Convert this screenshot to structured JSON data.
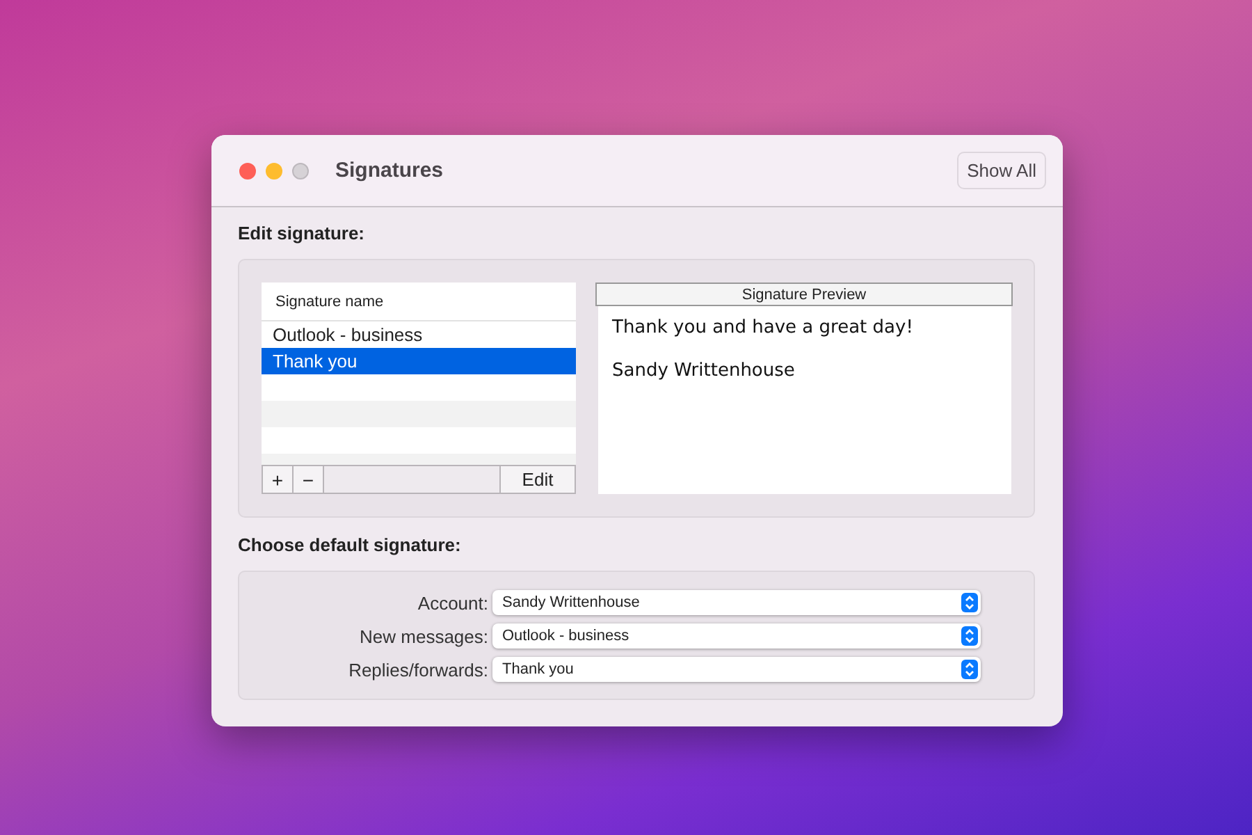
{
  "window": {
    "title": "Signatures",
    "controls": [
      {
        "kind": "close"
      },
      {
        "kind": "minimize"
      },
      {
        "kind": "zoom"
      }
    ],
    "toolbar_button": "Show All"
  },
  "edit_section": {
    "heading": "Edit signature:",
    "list": {
      "column": "Signature name",
      "rows": [
        {
          "label": "Outlook - business",
          "selected": false
        },
        {
          "label": "Thank you",
          "selected": true
        }
      ],
      "buttons": [
        {
          "kind": "add",
          "label": "+"
        },
        {
          "kind": "remove",
          "label": "−"
        },
        {
          "kind": "edit",
          "label": "Edit"
        }
      ]
    },
    "preview": {
      "header": "Signature Preview",
      "lines": [
        "Thank you and have a great day!",
        "Sandy Writtenhouse"
      ]
    }
  },
  "default_section": {
    "heading": "Choose default signature:",
    "fields": [
      {
        "label": "Account:",
        "value": "Sandy Writtenhouse"
      },
      {
        "label": "New messages:",
        "value": "Outlook - business"
      },
      {
        "label": "Replies/forwards:",
        "value": "Thank you"
      }
    ]
  }
}
